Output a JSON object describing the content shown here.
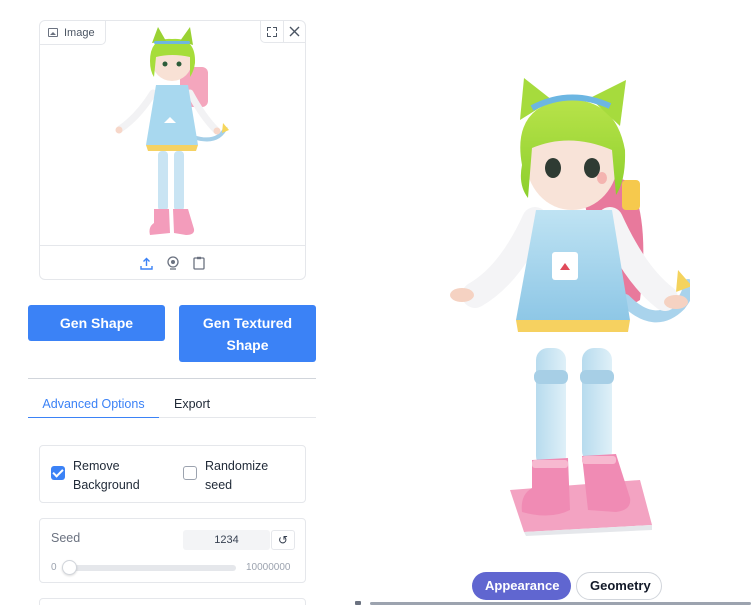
{
  "image_panel": {
    "label": "Image",
    "actions": [
      "fullscreen-icon",
      "close-icon"
    ],
    "footer_icons": [
      "upload-icon",
      "webcam-icon",
      "clipboard-icon"
    ]
  },
  "buttons": {
    "gen_shape": "Gen Shape",
    "gen_textured": "Gen Textured Shape"
  },
  "tabs": [
    {
      "label": "Advanced Options",
      "active": true
    },
    {
      "label": "Export",
      "active": false
    }
  ],
  "options": {
    "remove_background": {
      "label": "Remove Background",
      "checked": true
    },
    "randomize_seed": {
      "label": "Randomize seed",
      "checked": false
    }
  },
  "seed": {
    "label": "Seed",
    "value": "1234",
    "reset_icon": "reset-icon",
    "min": "0",
    "max": "10000000",
    "slider_fraction": 0.0001234
  },
  "viewer": {
    "modes": [
      {
        "label": "Appearance",
        "active": true
      },
      {
        "label": "Geometry",
        "active": false
      }
    ]
  },
  "colors": {
    "primary": "#3b82f6",
    "active_mode": "#6066d0",
    "border": "#e5e7eb"
  }
}
